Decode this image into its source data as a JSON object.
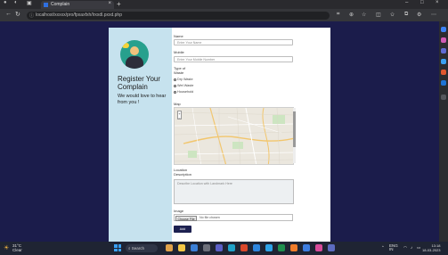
{
  "browser": {
    "tab_title": "Complain",
    "tab_close": "×",
    "new_tab": "+",
    "url": "localhost/xxxxx/pro/fpxaxfxh/lrxxdl.pxxd.php",
    "window_controls": [
      "–",
      "□",
      "×"
    ]
  },
  "left_panel": {
    "title": "Register Your Complain",
    "subtitle": "We would love to hear from you !"
  },
  "form": {
    "name_label": "Name",
    "name_placeholder": "Enter Your Name",
    "mobile_label": "Mobile",
    "mobile_placeholder": "Enter Your Mobile Number",
    "type_label": "Type of Waste",
    "type_options": [
      "Dry Waste",
      "Wet Waste",
      "Household"
    ],
    "map_label": "Map",
    "location_label": "Location Description",
    "location_placeholder": "Describe Location with Landmark Here",
    "file_label": "Image",
    "file_button": "Choose File",
    "file_name": "No file chosen",
    "submit_label": "Add"
  },
  "taskbar": {
    "weather_temp": "31°C",
    "weather_desc": "Clear",
    "search_label": "Search",
    "lang": "ENG IN",
    "time": "13:18",
    "date": "18-03-2023"
  },
  "colors": {
    "page_bg": "#1b1c4b",
    "left_panel_bg": "#c6e2ee",
    "submit_bg": "#1d2150",
    "avatar_bg": "#27a08d"
  }
}
